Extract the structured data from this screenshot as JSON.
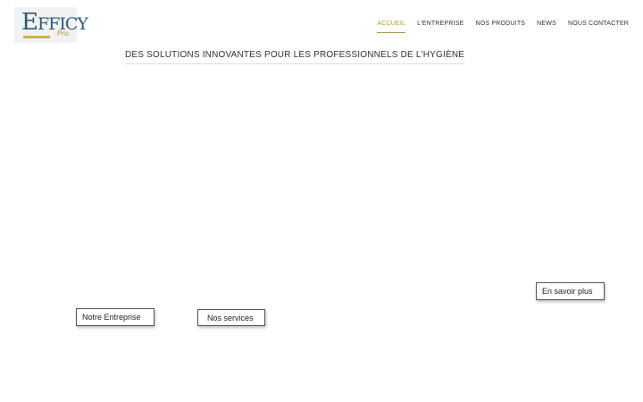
{
  "logo": {
    "letters_main": "E",
    "letters_rest": "FFICY",
    "sub": "Pro"
  },
  "nav": {
    "items": [
      {
        "label": "ACCUEIL",
        "active": true
      },
      {
        "label": "L'ENTREPRISE",
        "active": false
      },
      {
        "label": "NOS PRODUITS",
        "active": false
      },
      {
        "label": "NEWS",
        "active": false
      },
      {
        "label": "NOUS CONTACTER",
        "active": false
      }
    ]
  },
  "tagline": "DES SOLUTIONS INNOVANTES POUR LES PROFESSIONNELS DE L'HYGIÈNE",
  "buttons": {
    "entreprise": "Notre Entreprise",
    "services": "Nos services",
    "savoir": "En savoir plus"
  },
  "colors": {
    "accent": "#b59b27",
    "logo_blue": "#2f5b73",
    "text": "#333333"
  }
}
